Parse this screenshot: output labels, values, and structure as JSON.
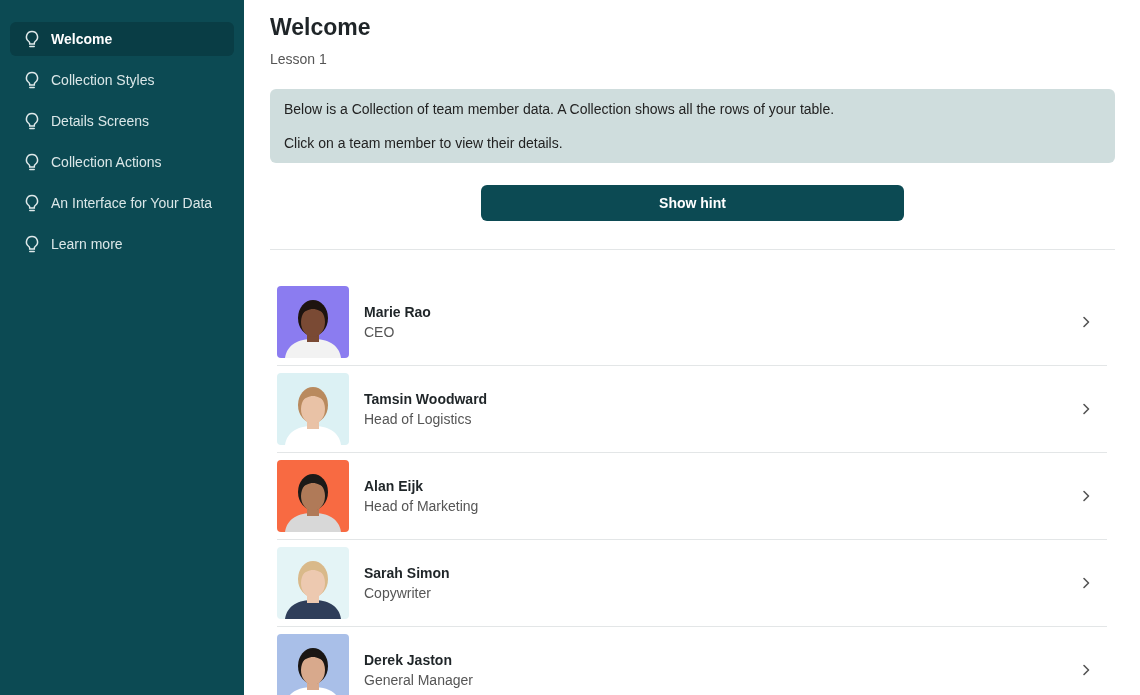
{
  "sidebar": {
    "items": [
      {
        "label": "Welcome",
        "selected": true
      },
      {
        "label": "Collection Styles",
        "selected": false
      },
      {
        "label": "Details Screens",
        "selected": false
      },
      {
        "label": "Collection Actions",
        "selected": false
      },
      {
        "label": "An Interface for Your Data",
        "selected": false
      },
      {
        "label": "Learn more",
        "selected": false
      }
    ]
  },
  "header": {
    "title": "Welcome",
    "subtitle": "Lesson 1"
  },
  "info": {
    "lines": [
      "Below is a Collection of team member data. A Collection shows all the rows of your table.",
      "Click on a team member to view their details."
    ]
  },
  "hint_button": "Show hint",
  "team": [
    {
      "name": "Marie Rao",
      "role": "CEO"
    },
    {
      "name": "Tamsin Woodward",
      "role": "Head of Logistics"
    },
    {
      "name": "Alan Eijk",
      "role": "Head of Marketing"
    },
    {
      "name": "Sarah Simon",
      "role": "Copywriter"
    },
    {
      "name": "Derek Jaston",
      "role": "General Manager"
    }
  ]
}
